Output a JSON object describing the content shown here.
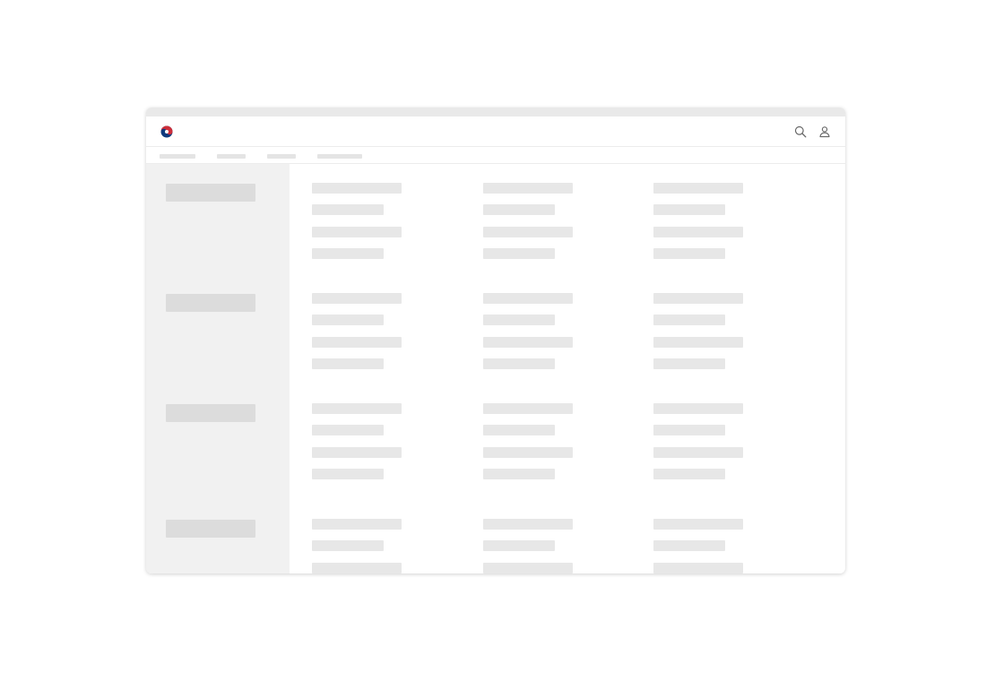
{
  "window": {
    "title": ""
  },
  "header": {
    "logo_icon": "korea-government-emblem-icon",
    "search_icon": "search-icon",
    "user_icon": "user-icon"
  },
  "nav": {
    "tabs": [
      "",
      "",
      "",
      ""
    ]
  },
  "state": "loading-skeleton",
  "colors": {
    "skeleton_light": "#e7e7e7",
    "skeleton_dark": "#dcdcdc",
    "sidebar_bg": "#f1f1f1",
    "emblem_red": "#cd2e3a",
    "emblem_blue": "#0f3a7d"
  },
  "sections": 4,
  "columns": 3,
  "rows_per_section": 4
}
